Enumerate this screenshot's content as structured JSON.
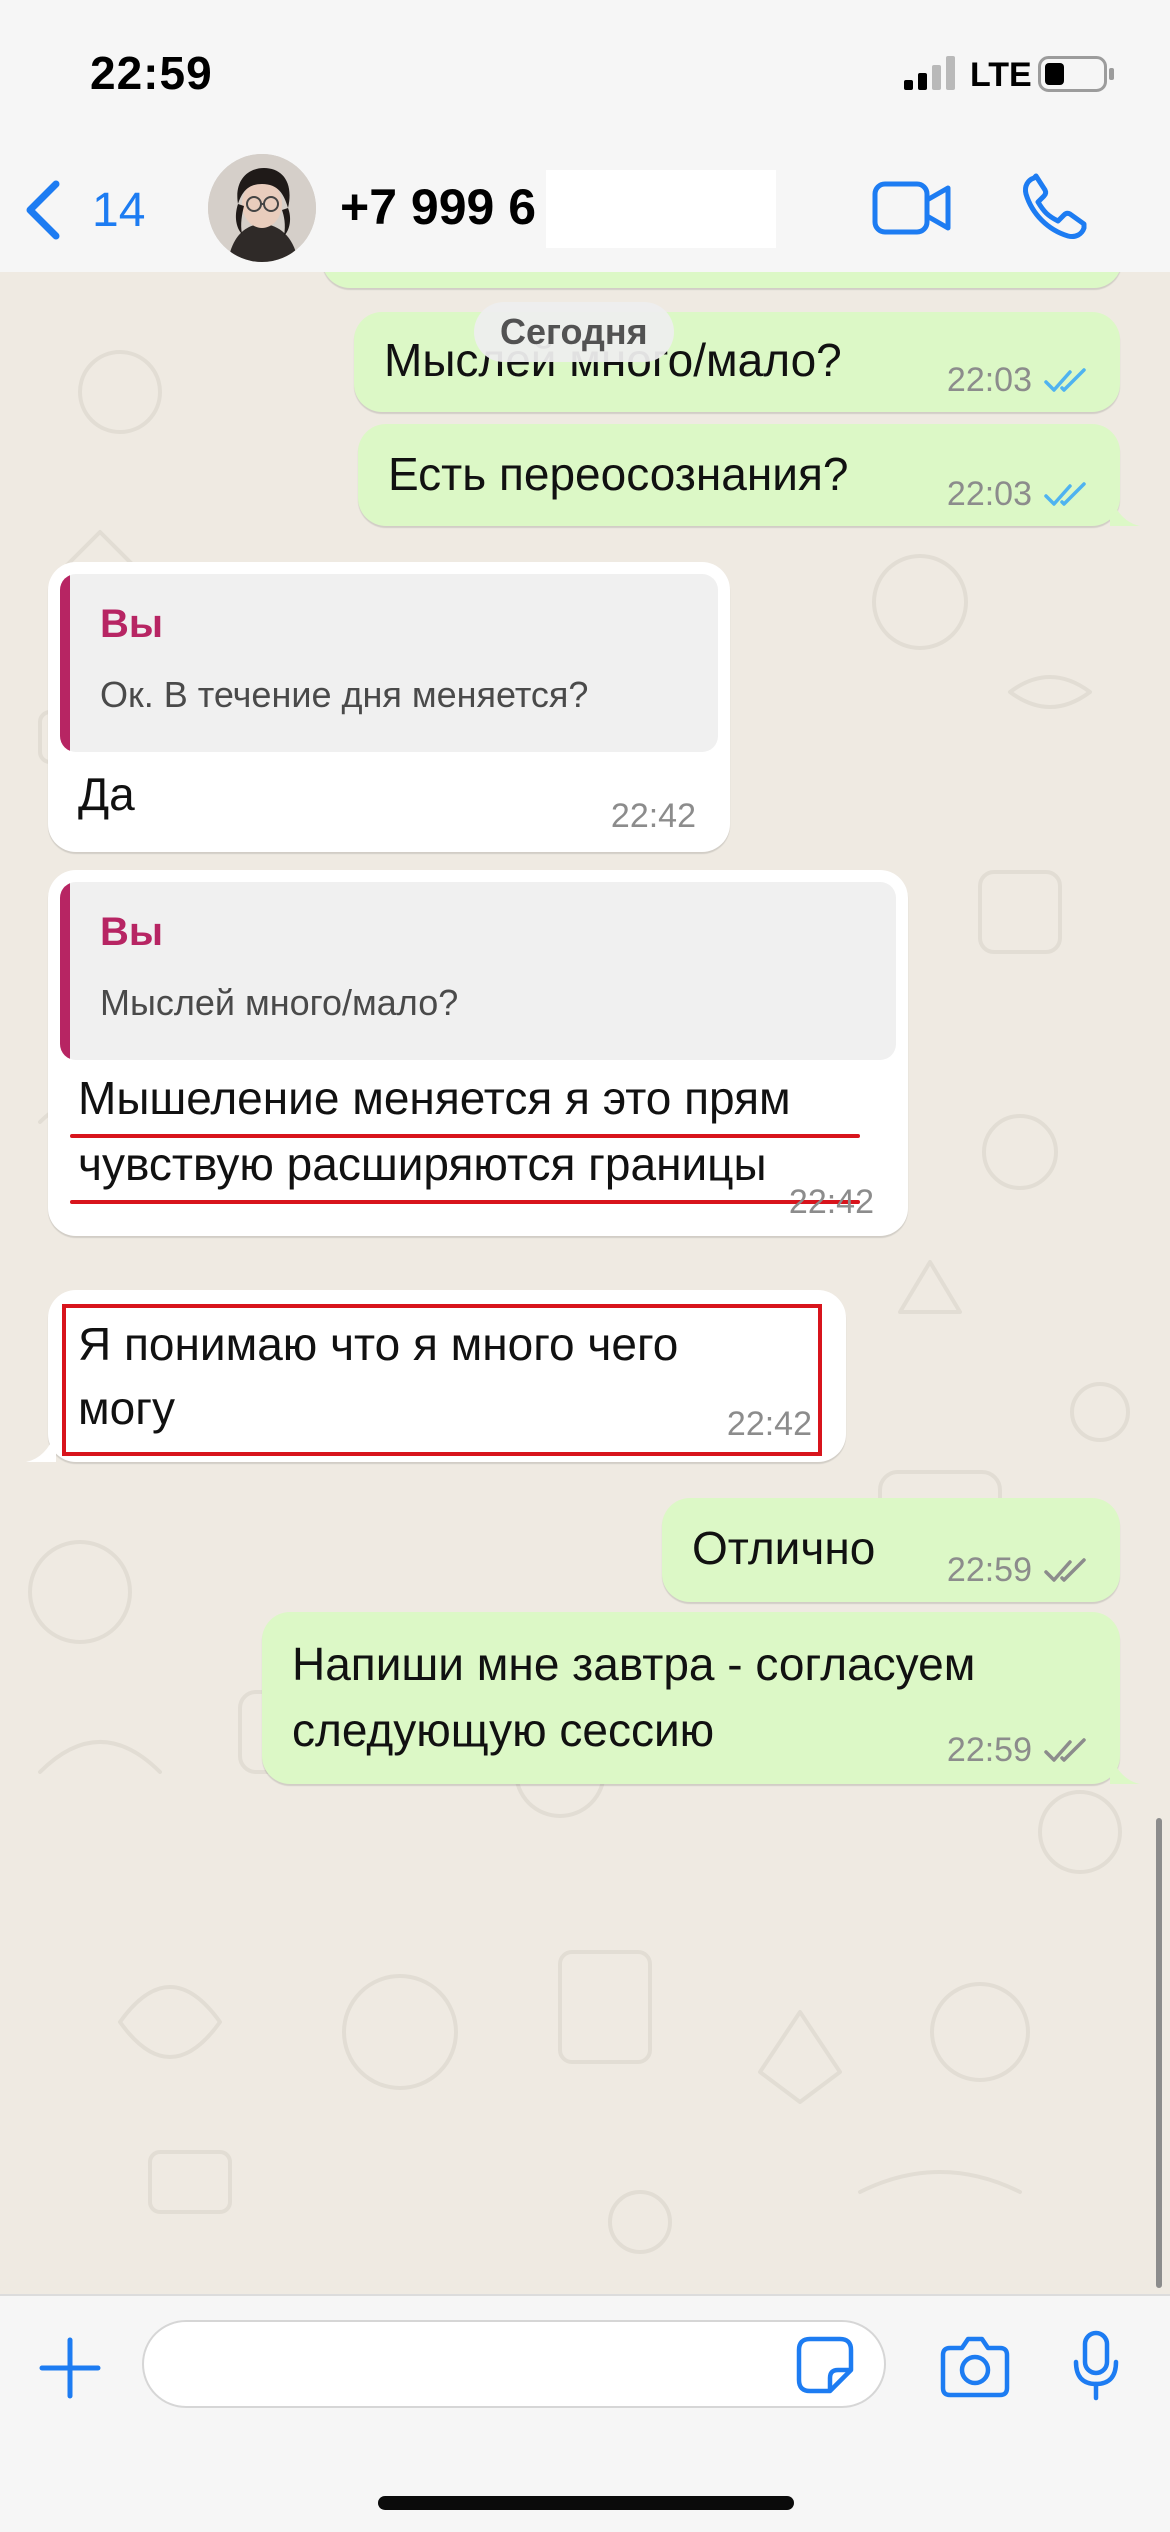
{
  "status_bar": {
    "time": "22:59",
    "network": "LTE",
    "signal_icon": "cellular-signal-icon",
    "battery_icon": "battery-low-icon"
  },
  "header": {
    "back_count": "14",
    "back_icon": "chevron-left-icon",
    "contact_name": "+7 999 6",
    "video_icon": "video-camera-icon",
    "call_icon": "phone-icon",
    "accent_color": "#1d7cf2"
  },
  "chat": {
    "date_separator": "Сегодня",
    "colors": {
      "outgoing_bubble": "#dcf8c6",
      "incoming_bubble": "#ffffff",
      "quote_author": "#b72563",
      "read_ticks": "#4fb3f0",
      "highlight_red": "#d8141c"
    },
    "messages": [
      {
        "direction": "out",
        "lines": [
          "Мыслей много/мало?"
        ],
        "time": "22:03",
        "status": "read"
      },
      {
        "direction": "out",
        "lines": [
          "Есть переосознания?"
        ],
        "time": "22:03",
        "status": "read"
      },
      {
        "direction": "in",
        "quote": {
          "author": "Вы",
          "text": "Ок. В течение дня меняется?"
        },
        "lines": [
          "Да"
        ],
        "time": "22:42"
      },
      {
        "direction": "in",
        "quote": {
          "author": "Вы",
          "text": "Мыслей много/мало?"
        },
        "lines": [
          "Мышеление меняется я это прям",
          "чувствую расширяются границы"
        ],
        "time": "22:42",
        "annotation": "red-underline"
      },
      {
        "direction": "in",
        "lines": [
          "Я понимаю что я  много чего",
          "могу"
        ],
        "time": "22:42",
        "annotation": "red-frame"
      },
      {
        "direction": "out",
        "lines": [
          "Отлично"
        ],
        "time": "22:59",
        "status": "delivered"
      },
      {
        "direction": "out",
        "lines": [
          "Напиши мне завтра - согласуем",
          "следующую сессию"
        ],
        "time": "22:59",
        "status": "delivered"
      }
    ]
  },
  "input_bar": {
    "placeholder": "",
    "plus_icon": "plus-icon",
    "sticker_icon": "sticker-icon",
    "camera_icon": "camera-icon",
    "mic_icon": "microphone-icon"
  }
}
